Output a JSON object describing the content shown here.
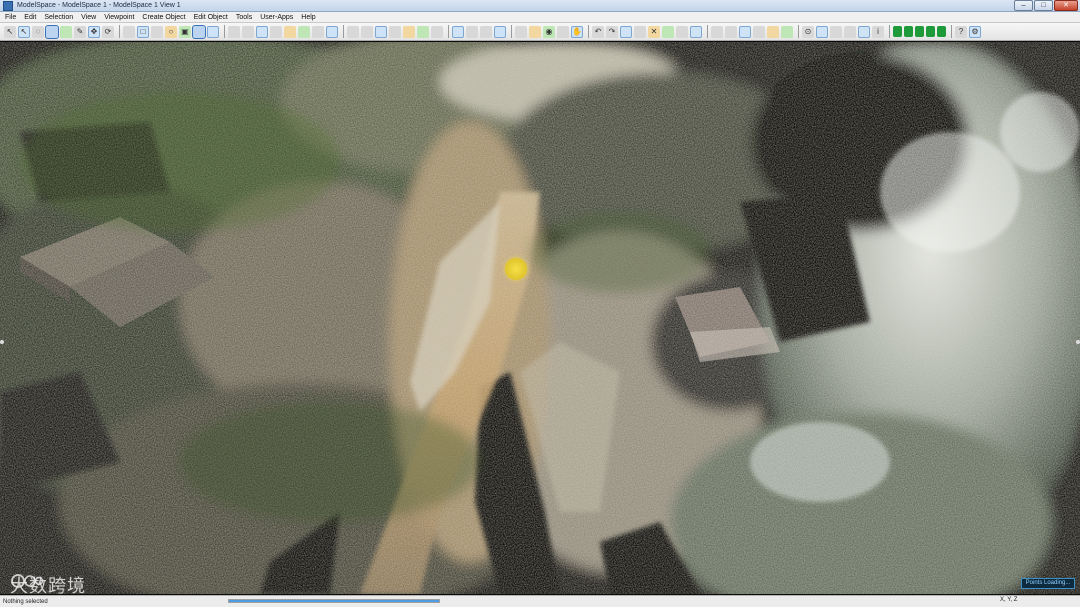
{
  "window": {
    "title": "ModelSpace - ModelSpace 1 - ModelSpace 1 View 1",
    "buttons": {
      "minimize": "–",
      "maximize": "□",
      "close": "✕"
    }
  },
  "menu": {
    "items": [
      "File",
      "Edit",
      "Selection",
      "View",
      "Viewpoint",
      "Create Object",
      "Edit Object",
      "Tools",
      "User-Apps",
      "Help"
    ]
  },
  "toolbar": {
    "icons": [
      "select-arrow-icon",
      "select-plus-icon",
      "lasso-icon",
      "fence-icon",
      "brush-icon",
      "pencil-icon",
      "move-icon",
      "rotate-icon",
      "sep",
      "measure-icon",
      "rectangle-icon",
      "polygon-icon",
      "circle-icon",
      "cube-icon",
      "zoom-window-icon",
      "seek-icon",
      "sep",
      "pan-icon",
      "walk-icon",
      "orbit-icon",
      "fly-icon",
      "zoom-icon",
      "zoom-extents-icon",
      "undo-view-icon",
      "redo-view-icon",
      "sep",
      "layers-icon",
      "visual-icon",
      "color-icon",
      "intensity-icon",
      "limit-box-icon",
      "slice-icon",
      "cloud-icon",
      "sep",
      "display-mode-icon",
      "point-size-icon",
      "shading-icon",
      "light-icon",
      "sep",
      "grid-icon",
      "render-icon",
      "camera-icon",
      "image-icon",
      "hand-icon",
      "sep",
      "undo-icon",
      "redo-icon",
      "copy-icon",
      "paste-icon",
      "delete-icon",
      "group-icon",
      "ungroup-icon",
      "snap-icon",
      "sep",
      "view-cube-icon",
      "front-view-icon",
      "top-view-icon",
      "iso-view-icon",
      "perspective-icon",
      "ortho-icon",
      "sep",
      "target-icon",
      "fit-icon",
      "clip-icon",
      "section-icon",
      "pointer-icon",
      "info-icon",
      "sep",
      "green-bar-1-icon",
      "green-bar-2-icon",
      "green-bar-3-icon",
      "green-bar-4-icon",
      "green-bar-5-icon",
      "sep",
      "help-icon",
      "settings-icon"
    ]
  },
  "viewport": {
    "name": "Point cloud 3D view",
    "loading_label": "Points Loading...",
    "load_progress": 0.2
  },
  "watermark": {
    "text": "大数跨境"
  },
  "status": {
    "selection": "Nothing selected",
    "coords_label": "X, Y, Z",
    "progress": 1.0
  },
  "colors": {
    "marker": "#f0d63a",
    "accent": "#3b71b8"
  }
}
